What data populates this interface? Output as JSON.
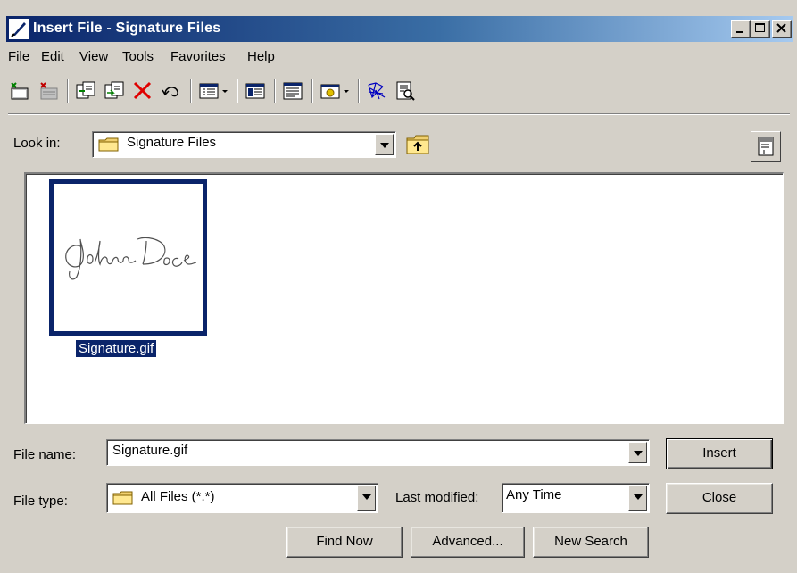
{
  "window": {
    "title": "Insert File - Signature Files",
    "controls": {
      "minimize": "_",
      "maximize": "□",
      "close": "×"
    }
  },
  "menu": [
    "File",
    "Edit",
    "View",
    "Tools",
    "Favorites",
    "Help"
  ],
  "toolbar": {
    "icons": [
      "new-folder-icon",
      "delete-icon-alt",
      "copy-icon",
      "move-icon",
      "delete-x-icon",
      "undo-icon",
      "views-icon",
      "details-icon",
      "properties-icon",
      "folder-options-icon",
      "web-icon",
      "preview-icon"
    ]
  },
  "look_in": {
    "label": "Look in:",
    "value": "Signature Files"
  },
  "files": [
    {
      "name": "Signature.gif",
      "preview_text": "John Doe",
      "selected": true
    }
  ],
  "file_name": {
    "label": "File name:",
    "value": "Signature.gif"
  },
  "file_type": {
    "label": "File type:",
    "value": "All Files (*.*)"
  },
  "last_modified": {
    "label": "Last modified:",
    "value": "Any Time"
  },
  "buttons": {
    "insert": "Insert",
    "close": "Close",
    "find_now": "Find Now",
    "advanced": "Advanced...",
    "new_search": "New Search"
  },
  "colors": {
    "title_start": "#0a246a",
    "title_end": "#a6caf0",
    "face": "#d4d0c8",
    "selection": "#0a246a"
  }
}
